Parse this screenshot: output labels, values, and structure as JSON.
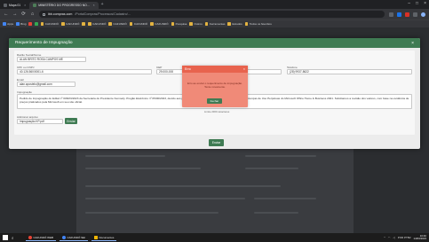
{
  "browser": {
    "tabs": [
      {
        "label": "Mapa 01",
        "active": false
      },
      {
        "label": "MINISTÉRIO DO PROGRESSO NO...",
        "active": true
      }
    ],
    "url_domain": "ibb.compras.com",
    "url_path": "/PortalCompras/Processos/Cadastro/...",
    "bookmarks": [
      {
        "label": "Apps",
        "color": "b"
      },
      {
        "label": "Bing",
        "color": "b"
      },
      {
        "label": "",
        "color": "r"
      },
      {
        "label": "",
        "color": "g"
      },
      {
        "label": "CAFUNDÓ",
        "color": "y"
      },
      {
        "label": "CAFUNDÓ",
        "color": "y"
      },
      {
        "label": "",
        "color": "y"
      },
      {
        "label": "CAFUNDÓ",
        "color": "y"
      },
      {
        "label": "CAFUNDÓ",
        "color": "y"
      },
      {
        "label": "CAFUNDÓ",
        "color": "y"
      },
      {
        "label": "CAFUNDÓ",
        "color": "y"
      },
      {
        "label": "Pesquisa",
        "color": "y"
      },
      {
        "label": "Outros",
        "color": "y"
      },
      {
        "label": "Ferramentas",
        "color": "y"
      },
      {
        "label": "Estudos",
        "color": "y"
      },
      {
        "label": "Todos os favoritos",
        "color": "y"
      }
    ]
  },
  "modal": {
    "title": "Requerimento de Impugnação",
    "close": "×",
    "fields": {
      "razao_social": {
        "label": "Razão Social/Nome",
        "value": "ALAN BRITO ROSA CAMPOS ME"
      },
      "cpf_cnpj": {
        "label": "CPF ou CNPJ",
        "value": "40.126.560/0001-6"
      },
      "cep": {
        "label": "CEP",
        "value": "29.000-000"
      },
      "telefone": {
        "label": "Telefone",
        "value": "(28) 9937-8622"
      },
      "email": {
        "label": "Email",
        "value": "alan.apostelo@gmail.com"
      },
      "impugnacao": {
        "label": "Impugnação",
        "value": "Pedido de Impugnação do Edital nº 008/23/2023 da Secretaria do Presidente Kennedy. Pregão Eletrônico nº 05/00/2023, devido aos preços muito abaixo de mercado para os itens 1 e 2, Licenças de Uso Perpétuas do Microsoft Office Home & Business 2021. Solicitamos a revisão dos valores, com base na evidência de preços praticados pela Microsoft em seu site oficial."
      },
      "counter": "Limite 2000 caracteres",
      "anexo": {
        "label": "Adicionar arquivo",
        "value": "Impugnação KP.pdf",
        "button": "Enviar"
      }
    },
    "submit": "Enviar"
  },
  "toast": {
    "title": "Erro",
    "message": "Erro ao enviar o requerimento de impugnação. Tente novamente.",
    "button": "Fechar"
  },
  "taskbar": {
    "apps": [
      {
        "label": "CAFUNDÓ WEB",
        "icon": "o"
      },
      {
        "label": "CAFUNDÓ SEI",
        "icon": "b"
      },
      {
        "label": "Documentos",
        "icon": "f"
      }
    ],
    "tray": "POR PTB2",
    "time": "10:40",
    "date": "14/03/2023"
  }
}
